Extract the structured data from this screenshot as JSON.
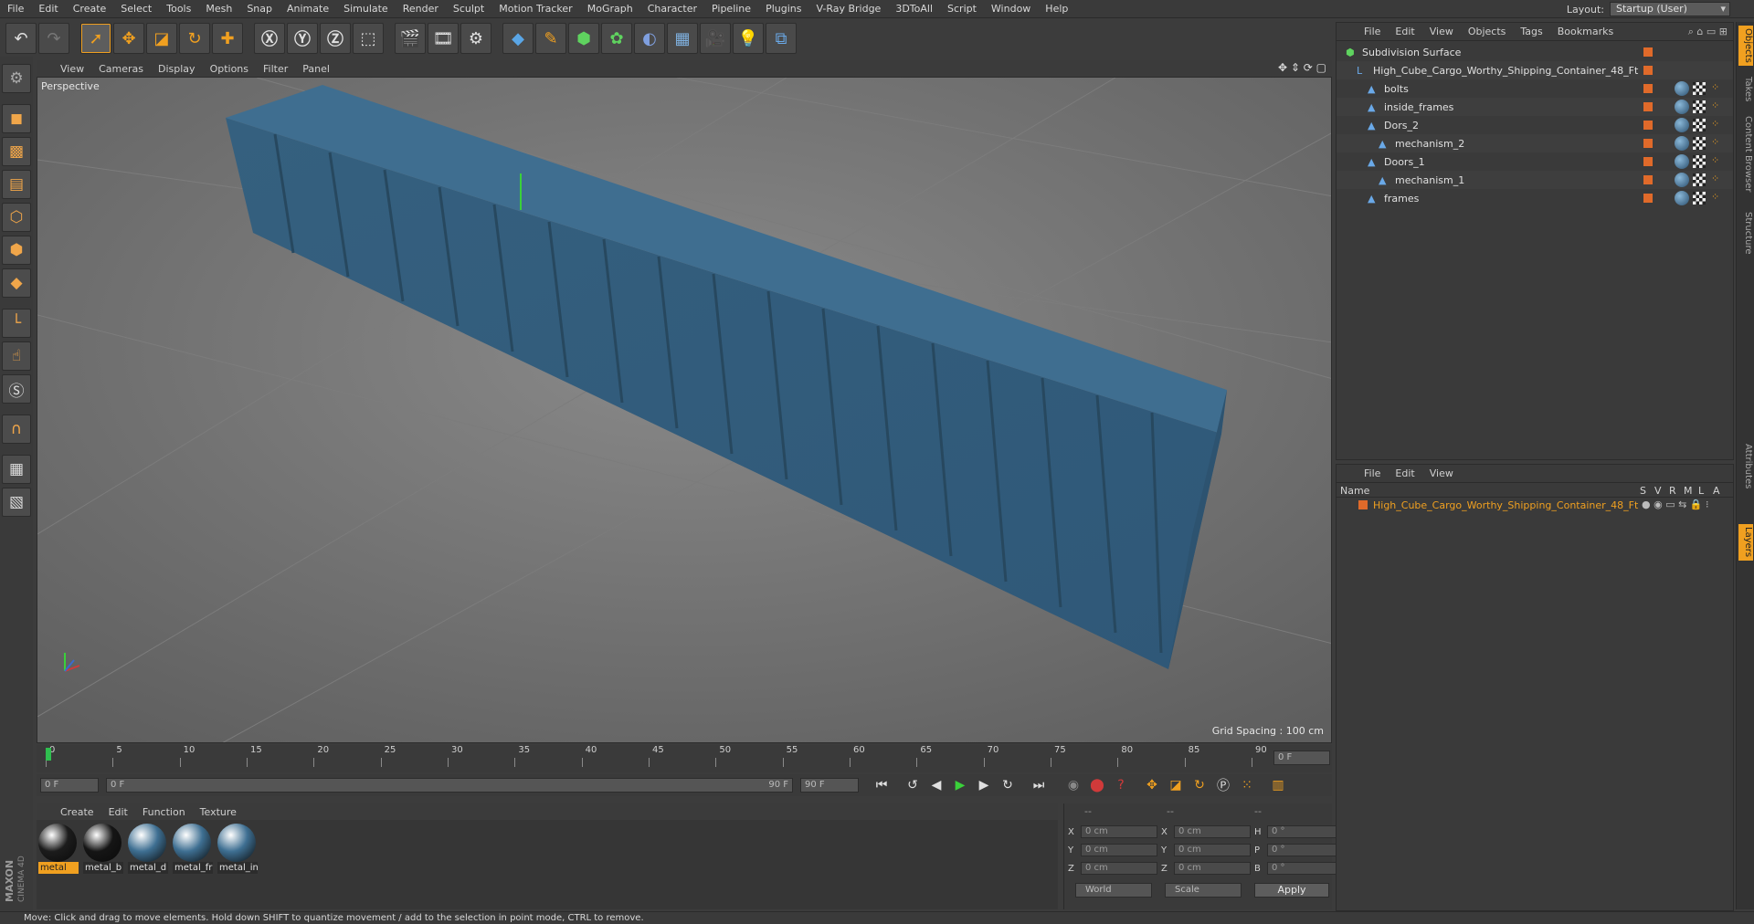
{
  "menu": [
    "File",
    "Edit",
    "Create",
    "Select",
    "Tools",
    "Mesh",
    "Snap",
    "Animate",
    "Simulate",
    "Render",
    "Sculpt",
    "Motion Tracker",
    "MoGraph",
    "Character",
    "Pipeline",
    "Plugins",
    "V-Ray Bridge",
    "3DToAll",
    "Script",
    "Window",
    "Help"
  ],
  "layout": {
    "label": "Layout:",
    "value": "Startup (User)"
  },
  "viewport": {
    "menu": [
      "View",
      "Cameras",
      "Display",
      "Options",
      "Filter",
      "Panel"
    ],
    "label": "Perspective",
    "grid_spacing": "Grid Spacing : 100 cm"
  },
  "timeline": {
    "ticks": [
      "0",
      "5",
      "10",
      "15",
      "20",
      "25",
      "30",
      "35",
      "40",
      "45",
      "50",
      "55",
      "60",
      "65",
      "70",
      "75",
      "80",
      "85",
      "90"
    ],
    "end_frame_field": "0 F",
    "current_frame": "0 F",
    "range_start": "0 F",
    "range_end": "90 F",
    "max_frame": "90 F"
  },
  "materials": {
    "menu": [
      "Create",
      "Edit",
      "Function",
      "Texture"
    ],
    "items": [
      {
        "name": "metal",
        "color": "#1c1c1c",
        "selected": true
      },
      {
        "name": "metal_b",
        "color": "#151515",
        "selected": false
      },
      {
        "name": "metal_d",
        "color": "#3e6f92",
        "selected": false
      },
      {
        "name": "metal_fr",
        "color": "#3e6f92",
        "selected": false
      },
      {
        "name": "metal_in",
        "color": "#3e6f92",
        "selected": false
      }
    ]
  },
  "coords": {
    "headers": [
      "--",
      "--",
      "--"
    ],
    "rows": [
      {
        "a_label": "X",
        "a": "0 cm",
        "b_label": "X",
        "b": "0 cm",
        "c_label": "H",
        "c": "0 °"
      },
      {
        "a_label": "Y",
        "a": "0 cm",
        "b_label": "Y",
        "b": "0 cm",
        "c_label": "P",
        "c": "0 °"
      },
      {
        "a_label": "Z",
        "a": "0 cm",
        "b_label": "Z",
        "b": "0 cm",
        "c_label": "B",
        "c": "0 °"
      }
    ],
    "space": "World",
    "mode": "Scale",
    "apply": "Apply"
  },
  "status": "Move: Click and drag to move elements. Hold down SHIFT to quantize movement / add to the selection in point mode, CTRL to remove.",
  "object_manager": {
    "menu": [
      "File",
      "Edit",
      "View",
      "Objects",
      "Tags",
      "Bookmarks"
    ],
    "objects": [
      {
        "name": "Subdivision Surface",
        "indent": 0,
        "icon": "subdivision-icon"
      },
      {
        "name": "High_Cube_Cargo_Worthy_Shipping_Container_48_Ft",
        "indent": 1,
        "icon": "null-icon"
      },
      {
        "name": "bolts",
        "indent": 2,
        "icon": "polygon-icon"
      },
      {
        "name": "inside_frames",
        "indent": 2,
        "icon": "polygon-icon"
      },
      {
        "name": "Dors_2",
        "indent": 2,
        "icon": "polygon-icon"
      },
      {
        "name": "mechanism_2",
        "indent": 3,
        "icon": "polygon-icon"
      },
      {
        "name": "Doors_1",
        "indent": 2,
        "icon": "polygon-icon"
      },
      {
        "name": "mechanism_1",
        "indent": 3,
        "icon": "polygon-icon"
      },
      {
        "name": "frames",
        "indent": 2,
        "icon": "polygon-icon"
      }
    ]
  },
  "layer_manager": {
    "menu": [
      "File",
      "Edit",
      "View"
    ],
    "columns": [
      "Name",
      "S",
      "V",
      "R",
      "M",
      "L",
      "A"
    ],
    "layers": [
      {
        "name": "High_Cube_Cargo_Worthy_Shipping_Container_48_Ft",
        "color": "#e06a2a"
      }
    ]
  },
  "right_tabs": [
    "Objects",
    "Takes",
    "Content Browser",
    "Structure",
    "Attributes",
    "Layers"
  ],
  "colors": {
    "accent": "#f0a020",
    "container": "#3f6e90",
    "name_highlight": "#f0a020"
  }
}
